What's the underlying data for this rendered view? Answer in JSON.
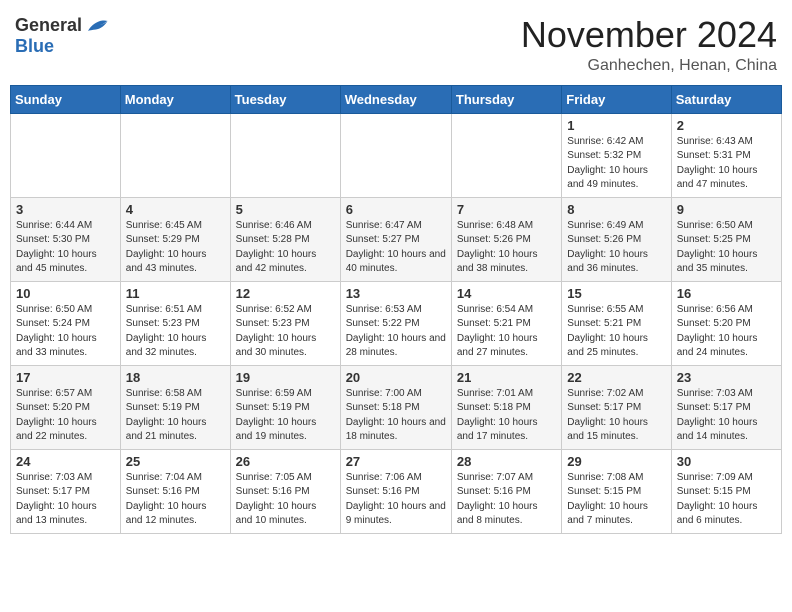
{
  "header": {
    "logo_general": "General",
    "logo_blue": "Blue",
    "month_title": "November 2024",
    "location": "Ganhechen, Henan, China"
  },
  "weekdays": [
    "Sunday",
    "Monday",
    "Tuesday",
    "Wednesday",
    "Thursday",
    "Friday",
    "Saturday"
  ],
  "weeks": [
    [
      {
        "day": "",
        "info": ""
      },
      {
        "day": "",
        "info": ""
      },
      {
        "day": "",
        "info": ""
      },
      {
        "day": "",
        "info": ""
      },
      {
        "day": "",
        "info": ""
      },
      {
        "day": "1",
        "info": "Sunrise: 6:42 AM\nSunset: 5:32 PM\nDaylight: 10 hours and 49 minutes."
      },
      {
        "day": "2",
        "info": "Sunrise: 6:43 AM\nSunset: 5:31 PM\nDaylight: 10 hours and 47 minutes."
      }
    ],
    [
      {
        "day": "3",
        "info": "Sunrise: 6:44 AM\nSunset: 5:30 PM\nDaylight: 10 hours and 45 minutes."
      },
      {
        "day": "4",
        "info": "Sunrise: 6:45 AM\nSunset: 5:29 PM\nDaylight: 10 hours and 43 minutes."
      },
      {
        "day": "5",
        "info": "Sunrise: 6:46 AM\nSunset: 5:28 PM\nDaylight: 10 hours and 42 minutes."
      },
      {
        "day": "6",
        "info": "Sunrise: 6:47 AM\nSunset: 5:27 PM\nDaylight: 10 hours and 40 minutes."
      },
      {
        "day": "7",
        "info": "Sunrise: 6:48 AM\nSunset: 5:26 PM\nDaylight: 10 hours and 38 minutes."
      },
      {
        "day": "8",
        "info": "Sunrise: 6:49 AM\nSunset: 5:26 PM\nDaylight: 10 hours and 36 minutes."
      },
      {
        "day": "9",
        "info": "Sunrise: 6:50 AM\nSunset: 5:25 PM\nDaylight: 10 hours and 35 minutes."
      }
    ],
    [
      {
        "day": "10",
        "info": "Sunrise: 6:50 AM\nSunset: 5:24 PM\nDaylight: 10 hours and 33 minutes."
      },
      {
        "day": "11",
        "info": "Sunrise: 6:51 AM\nSunset: 5:23 PM\nDaylight: 10 hours and 32 minutes."
      },
      {
        "day": "12",
        "info": "Sunrise: 6:52 AM\nSunset: 5:23 PM\nDaylight: 10 hours and 30 minutes."
      },
      {
        "day": "13",
        "info": "Sunrise: 6:53 AM\nSunset: 5:22 PM\nDaylight: 10 hours and 28 minutes."
      },
      {
        "day": "14",
        "info": "Sunrise: 6:54 AM\nSunset: 5:21 PM\nDaylight: 10 hours and 27 minutes."
      },
      {
        "day": "15",
        "info": "Sunrise: 6:55 AM\nSunset: 5:21 PM\nDaylight: 10 hours and 25 minutes."
      },
      {
        "day": "16",
        "info": "Sunrise: 6:56 AM\nSunset: 5:20 PM\nDaylight: 10 hours and 24 minutes."
      }
    ],
    [
      {
        "day": "17",
        "info": "Sunrise: 6:57 AM\nSunset: 5:20 PM\nDaylight: 10 hours and 22 minutes."
      },
      {
        "day": "18",
        "info": "Sunrise: 6:58 AM\nSunset: 5:19 PM\nDaylight: 10 hours and 21 minutes."
      },
      {
        "day": "19",
        "info": "Sunrise: 6:59 AM\nSunset: 5:19 PM\nDaylight: 10 hours and 19 minutes."
      },
      {
        "day": "20",
        "info": "Sunrise: 7:00 AM\nSunset: 5:18 PM\nDaylight: 10 hours and 18 minutes."
      },
      {
        "day": "21",
        "info": "Sunrise: 7:01 AM\nSunset: 5:18 PM\nDaylight: 10 hours and 17 minutes."
      },
      {
        "day": "22",
        "info": "Sunrise: 7:02 AM\nSunset: 5:17 PM\nDaylight: 10 hours and 15 minutes."
      },
      {
        "day": "23",
        "info": "Sunrise: 7:03 AM\nSunset: 5:17 PM\nDaylight: 10 hours and 14 minutes."
      }
    ],
    [
      {
        "day": "24",
        "info": "Sunrise: 7:03 AM\nSunset: 5:17 PM\nDaylight: 10 hours and 13 minutes."
      },
      {
        "day": "25",
        "info": "Sunrise: 7:04 AM\nSunset: 5:16 PM\nDaylight: 10 hours and 12 minutes."
      },
      {
        "day": "26",
        "info": "Sunrise: 7:05 AM\nSunset: 5:16 PM\nDaylight: 10 hours and 10 minutes."
      },
      {
        "day": "27",
        "info": "Sunrise: 7:06 AM\nSunset: 5:16 PM\nDaylight: 10 hours and 9 minutes."
      },
      {
        "day": "28",
        "info": "Sunrise: 7:07 AM\nSunset: 5:16 PM\nDaylight: 10 hours and 8 minutes."
      },
      {
        "day": "29",
        "info": "Sunrise: 7:08 AM\nSunset: 5:15 PM\nDaylight: 10 hours and 7 minutes."
      },
      {
        "day": "30",
        "info": "Sunrise: 7:09 AM\nSunset: 5:15 PM\nDaylight: 10 hours and 6 minutes."
      }
    ]
  ]
}
